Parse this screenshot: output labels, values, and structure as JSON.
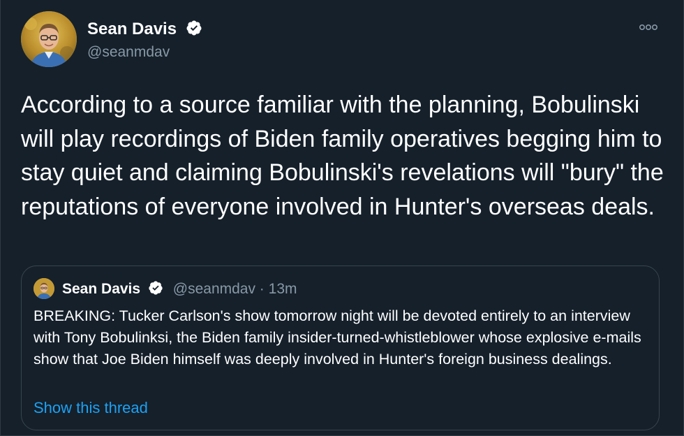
{
  "author": {
    "display_name": "Sean Davis",
    "handle": "@seanmdav",
    "verified": true,
    "avatar_icon": "profile-photo-icon"
  },
  "tweet": {
    "text": "According to a source familiar with the planning, Bobulinski will play recordings of Biden family operatives begging him to stay quiet and claiming Bobulinski's revelations will \"bury\" the reputations of everyone involved in Hunter's overseas deals."
  },
  "quoted_tweet": {
    "display_name": "Sean Davis",
    "meta": "@seanmdav · 13m",
    "text": "BREAKING: Tucker Carlson's show tomorrow night will be devoted entirely to an interview with Tony Bobulinksi, the Biden family insider-turned-whistleblower whose explosive e-mails show that Joe Biden himself was deeply involved in Hunter's foreign business dealings.",
    "show_thread": "Show this thread"
  },
  "colors": {
    "background": "#15202b",
    "accent": "#1da1f2",
    "secondary_text": "#8899a6",
    "border": "#38444d"
  },
  "icons": {
    "verified": "verified-badge-icon",
    "more": "more-options-icon"
  }
}
